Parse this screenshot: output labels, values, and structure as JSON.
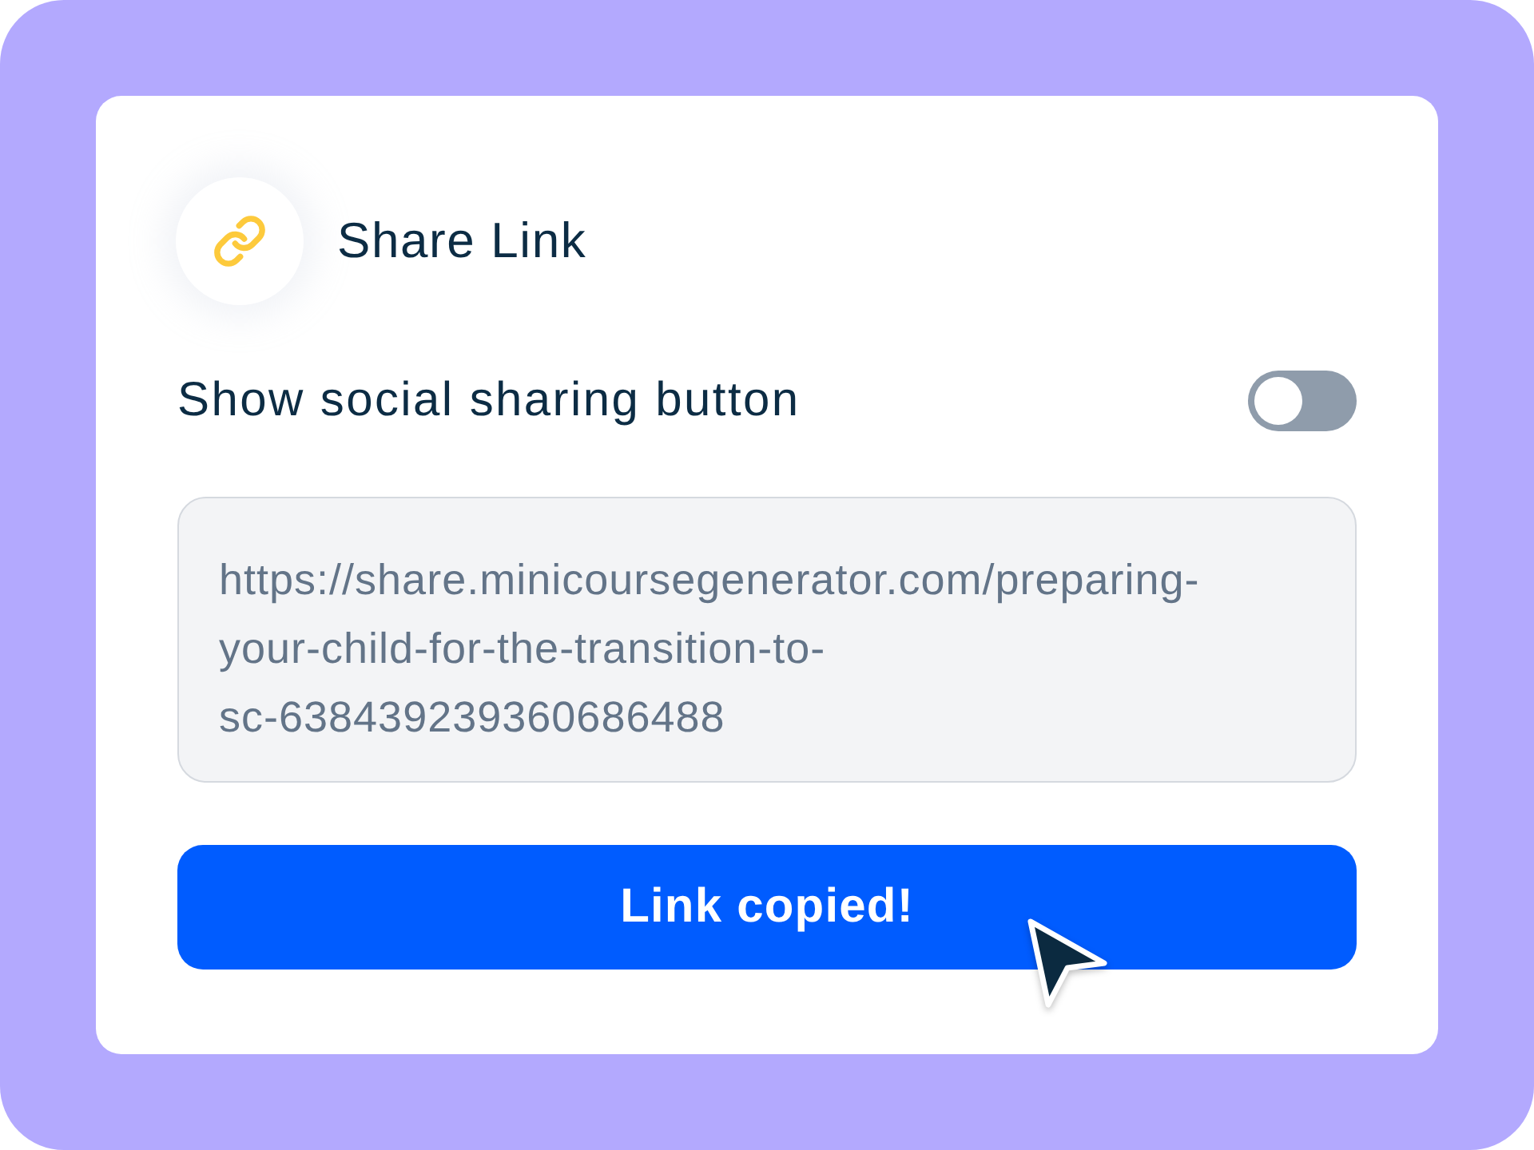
{
  "card": {
    "header": {
      "title": "Share Link"
    },
    "social_toggle": {
      "label": "Show social sharing button",
      "on": false
    },
    "link_field": {
      "value": "https://share.minicoursegenerator.com/preparing-your-child-for-the-transition-to-sc-638439239360686488"
    },
    "copy_button": {
      "label": "Link copied!"
    }
  }
}
